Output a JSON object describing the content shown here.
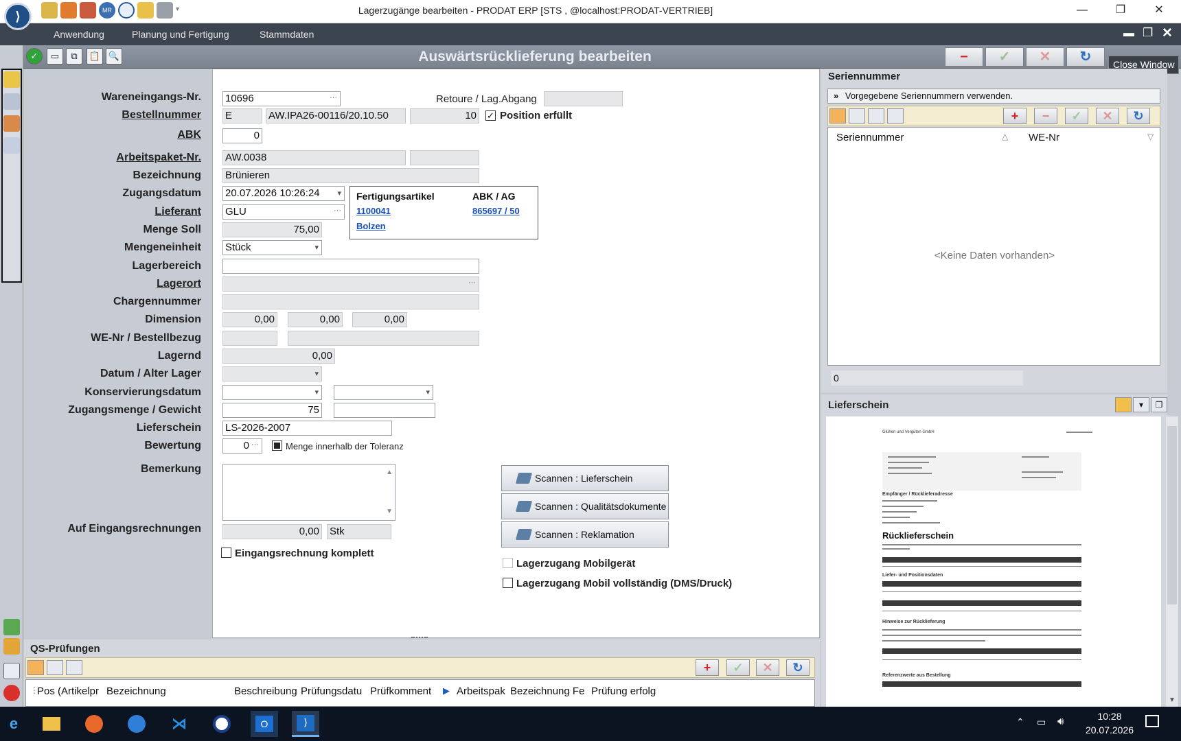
{
  "window": {
    "title": "Lagerzugänge bearbeiten - PRODAT ERP   [STS ,  @localhost:PRODAT-VERTRIEB]",
    "minimize": "—",
    "maximize": "❐",
    "close": "✕"
  },
  "menu": {
    "items": [
      "Anwendung",
      "Planung und Fertigung",
      "Stammdaten"
    ]
  },
  "header": {
    "title": "Auswärtsrücklieferung bearbeiten",
    "tooltip": "Close Window",
    "btn_minus": "−",
    "btn_ok": "✓",
    "btn_cancel": "✕",
    "btn_refresh": "↻"
  },
  "form": {
    "labels": {
      "wareneingang": "Wareneingangs-Nr.",
      "bestellnummer": "Bestellnummer",
      "abk": "ABK",
      "arbeitspaket": "Arbeitspaket-Nr.",
      "bezeichnung": "Bezeichnung",
      "zugangsdatum": "Zugangsdatum",
      "lieferant": "Lieferant",
      "menge_soll": "Menge Soll",
      "mengeneinheit": "Mengeneinheit",
      "lagerbereich": "Lagerbereich",
      "lagerort": "Lagerort",
      "chargennummer": "Chargennummer",
      "dimension": "Dimension",
      "we_nr": "WE-Nr / Bestellbezug",
      "lagernd": "Lagernd",
      "datum_alter": "Datum / Alter Lager",
      "konservierung": "Konservierungsdatum",
      "zugangsmenge": "Zugangsmenge / Gewicht",
      "lieferschein": "Lieferschein",
      "bewertung": "Bewertung",
      "bemerkung": "Bemerkung",
      "eingangsrechnungen": "Auf Eingangsrechnungen",
      "retoure": "Retoure / Lag.Abgang"
    },
    "values": {
      "wareneingang": "10696",
      "bestell_typ": "E",
      "bestell_nr": "AW.IPA26-00116/20.10.50",
      "bestell_pos": "10",
      "position_erfuellt": "Position erfüllt",
      "abk": "0",
      "arbeitspaket": "AW.0038",
      "bezeichnung": "Brünieren",
      "zugangsdatum": "20.07.2026 10:26:24",
      "lieferant": "GLU",
      "menge_soll": "75,00",
      "mengeneinheit": "Stück",
      "dim1": "0,00",
      "dim2": "0,00",
      "dim3": "0,00",
      "lagernd": "0,00",
      "zugangsmenge": "75",
      "lieferschein": "LS-2026-2007",
      "bewertung": "0",
      "toleranz": "Menge innerhalb der Toleranz",
      "eingangsrechnung_menge": "0,00",
      "eingangsrechnung_einheit": "Stk",
      "eingangsrechnung_komplett": "Eingangsrechnung komplett",
      "mobil": "Lagerzugang Mobilgerät",
      "mobil_vollstaendig": "Lagerzugang Mobil vollständig (DMS/Druck)"
    },
    "fertigung": {
      "header_artikel": "Fertigungsartikel",
      "header_abk": "ABK / AG",
      "artikel_nr": "1100041",
      "abk_ag": "865697 / 50",
      "artikel_name": "Bolzen"
    },
    "scan": {
      "lieferschein": "Scannen : Lieferschein",
      "quali": "Scannen : Qualitätsdokumente",
      "reklamation": "Scannen : Reklamation"
    }
  },
  "serien": {
    "title": "Seriennummer",
    "hint": "Vorgegebene Seriennummern verwenden.",
    "col1": "Seriennummer",
    "col2": "WE-Nr",
    "empty": "<Keine Daten vorhanden>",
    "count": "0"
  },
  "lieferschein_panel": {
    "title": "Lieferschein",
    "doc_company": "Glühen und Vergüten GmbH",
    "doc_heading": "Rücklieferschein",
    "doc_recipient": "Empfänger / Rücklieferadresse",
    "doc_section1": "Liefer- und Positionsdaten",
    "doc_section2": "Hinweise zur Rücklieferung",
    "doc_section3": "Referenzwerte aus Bestellung"
  },
  "qs": {
    "title": "QS-Prüfungen",
    "columns": [
      "Pos (Artikelpr",
      "Bezeichnung",
      "Beschreibung",
      "Prüfungsdatu",
      "Prüfkomment",
      "Arbeitspak",
      "Bezeichnung Fe",
      "Prüfung erfolg"
    ]
  },
  "taskbar": {
    "time": "10:28",
    "date": "20.07.2026"
  }
}
